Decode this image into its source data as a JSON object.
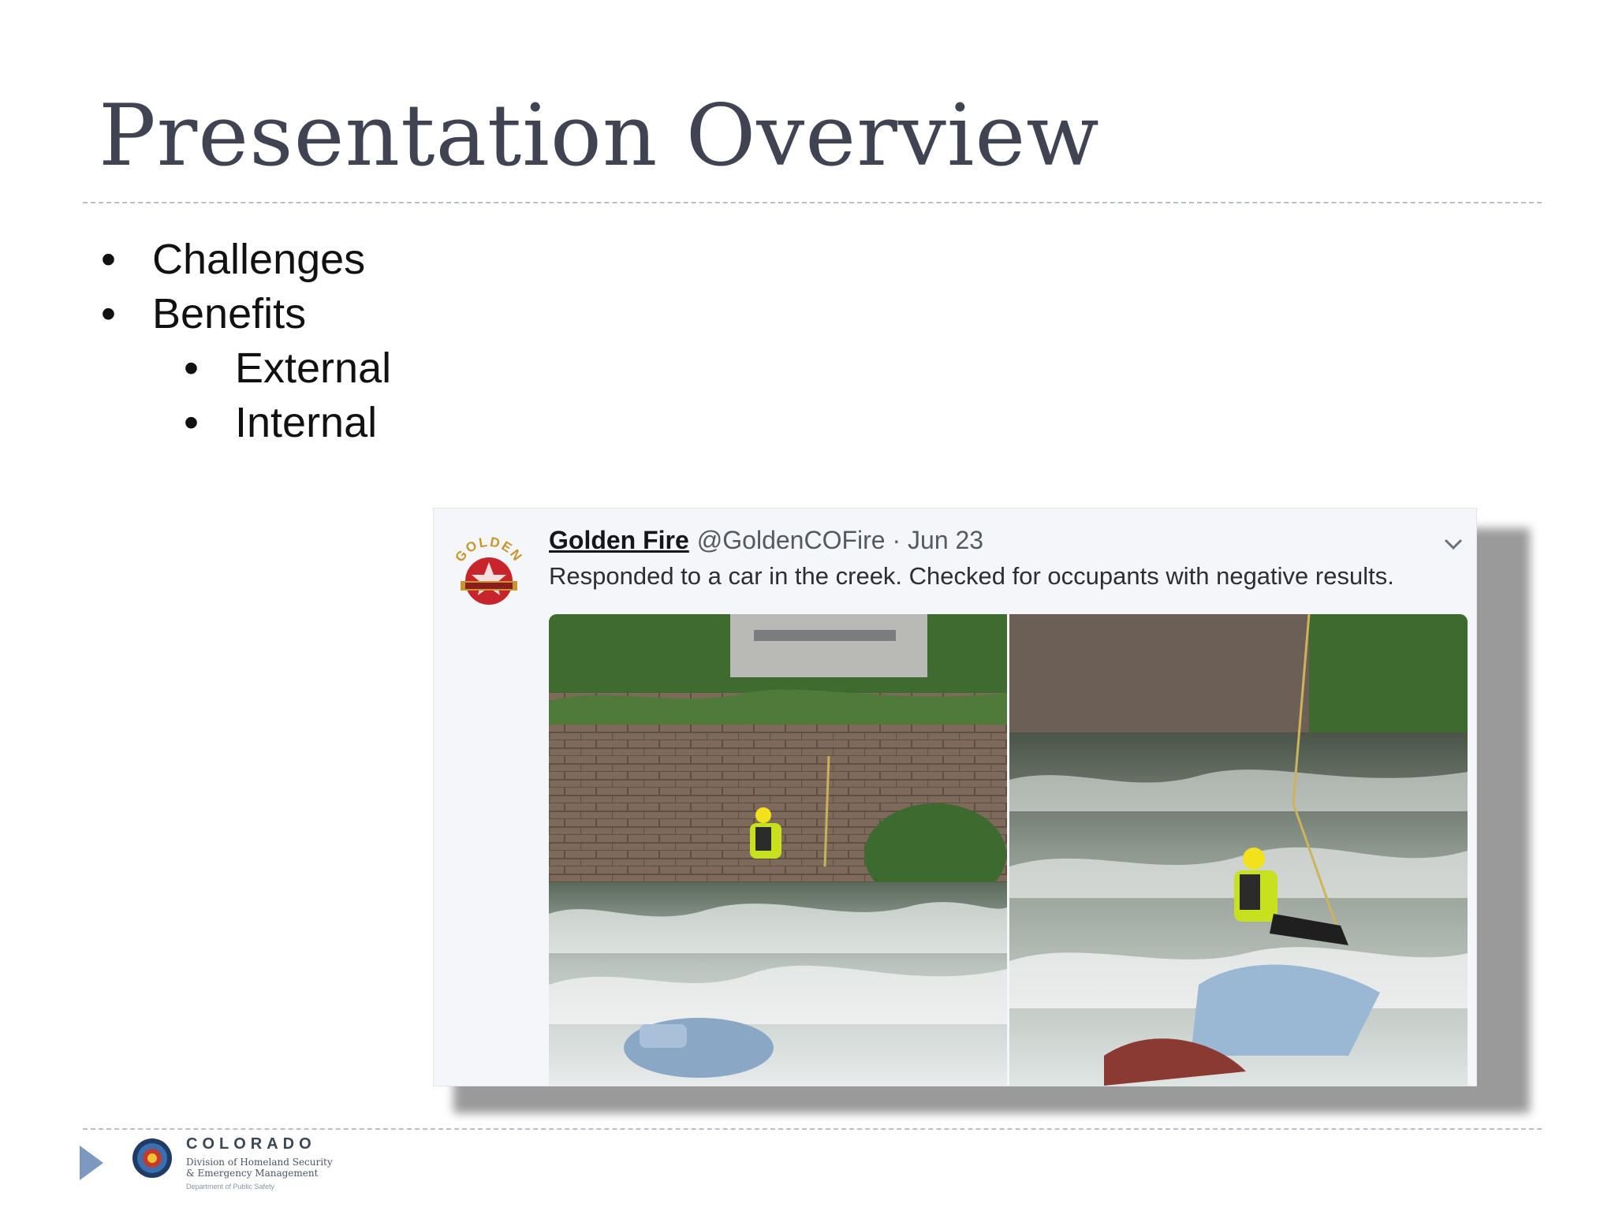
{
  "slide": {
    "title": "Presentation Overview",
    "bullets": [
      {
        "text": "Challenges",
        "level": 1
      },
      {
        "text": "Benefits",
        "level": 1
      },
      {
        "text": "External",
        "level": 2
      },
      {
        "text": "Internal",
        "level": 2
      }
    ],
    "bullet_glyph": "•"
  },
  "tweet": {
    "name": "Golden Fire",
    "handle": "@GoldenCOFire",
    "date": "· Jun 23",
    "text": "Responded to a car in the creek.  Checked for occupants with negative results.",
    "logo_text": "GOLDEN",
    "menu_icon": "chevron-down-icon"
  },
  "footer": {
    "org_state": "COLORADO",
    "org_division_line1": "Division of Homeland Security",
    "org_division_line2": "& Emergency Management",
    "org_department": "Department of Public Safety"
  },
  "colors": {
    "title": "#404452",
    "accent": "#7e99bf",
    "rule": "#b9bec6"
  }
}
